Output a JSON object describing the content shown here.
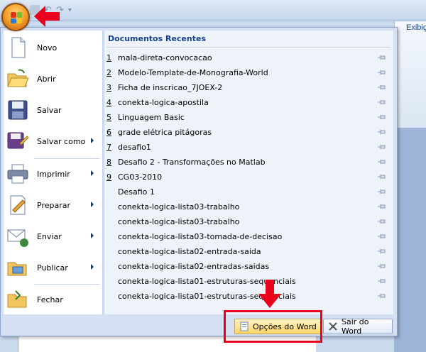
{
  "background": {
    "ribbon_tab": "Exibiç"
  },
  "qat": {
    "undo_icon": "undo-icon",
    "redo_icon": "redo-icon",
    "customize_icon": "customize-qat-icon"
  },
  "menu": {
    "commands": [
      {
        "label": "Novo",
        "icon": "new-document-icon",
        "submenu": false
      },
      {
        "label": "Abrir",
        "icon": "open-folder-icon",
        "submenu": false
      },
      {
        "label": "Salvar",
        "icon": "save-disk-icon",
        "submenu": false
      },
      {
        "label": "Salvar como",
        "icon": "save-as-icon",
        "submenu": true
      },
      {
        "label": "Imprimir",
        "icon": "printer-icon",
        "submenu": true
      },
      {
        "label": "Preparar",
        "icon": "prepare-icon",
        "submenu": true
      },
      {
        "label": "Enviar",
        "icon": "send-icon",
        "submenu": true
      },
      {
        "label": "Publicar",
        "icon": "publish-icon",
        "submenu": true
      },
      {
        "label": "Fechar",
        "icon": "close-folder-icon",
        "submenu": false
      }
    ],
    "recent": {
      "title": "Documentos Recentes",
      "items": [
        {
          "num": "1",
          "name": "mala-direta-convocacao"
        },
        {
          "num": "2",
          "name": "Modelo-Template-de-Monografia-World"
        },
        {
          "num": "3",
          "name": "Ficha de inscricao_7JOEX-2"
        },
        {
          "num": "4",
          "name": "conekta-logica-apostila"
        },
        {
          "num": "5",
          "name": "Linguagem Basic"
        },
        {
          "num": "6",
          "name": "grade elétrica pitágoras"
        },
        {
          "num": "7",
          "name": "desafio1"
        },
        {
          "num": "8",
          "name": "Desafio 2 - Transformações no Matlab"
        },
        {
          "num": "9",
          "name": "CG03-2010"
        },
        {
          "num": "",
          "name": "Desafio 1"
        },
        {
          "num": "",
          "name": "conekta-logica-lista03-trabalho"
        },
        {
          "num": "",
          "name": "conekta-logica-lista03-trabalho"
        },
        {
          "num": "",
          "name": "conekta-logica-lista03-tomada-de-decisao"
        },
        {
          "num": "",
          "name": "conekta-logica-lista02-entrada-saida"
        },
        {
          "num": "",
          "name": "conekta-logica-lista02-entradas-saidas"
        },
        {
          "num": "",
          "name": "conekta-logica-lista01-estruturas-sequenciais"
        },
        {
          "num": "",
          "name": "conekta-logica-lista01-estruturas-sequenciais"
        }
      ]
    },
    "buttons": {
      "options": "Opções do Word",
      "exit": "Sair do Word"
    }
  },
  "colors": {
    "annotation": "#e8001c",
    "accent": "#15428b"
  }
}
